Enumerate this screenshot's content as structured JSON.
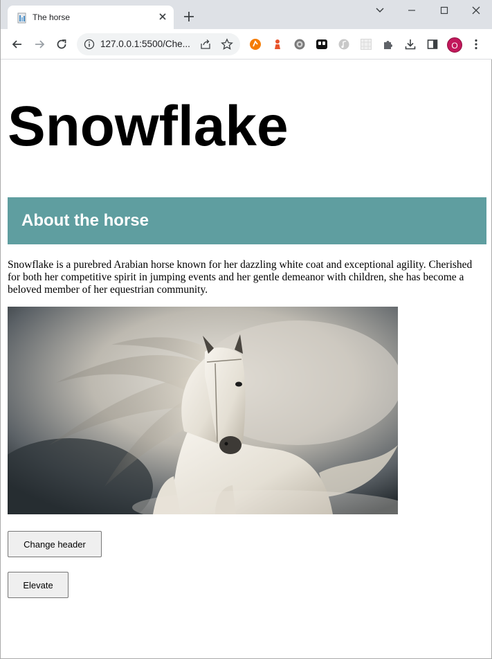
{
  "browser": {
    "tab_title": "The horse",
    "url": "127.0.0.1:5500/Che...",
    "profile_initial": "O"
  },
  "page": {
    "title": "Snowflake",
    "section_heading": "About the horse",
    "section_color": "#5f9ea0",
    "description": "Snowflake is a purebred Arabian horse known for her dazzling white coat and exceptional agility. Cherished for both her competitive spirit in jumping events and her gentle demeanor with children, she has become a beloved member of her equestrian community.",
    "buttons": {
      "change_header": "Change header",
      "elevate": "Elevate"
    }
  },
  "icons": [
    "tab-favicon",
    "close-icon",
    "plus-icon",
    "chevron-down-icon",
    "minimize-icon",
    "maximize-icon",
    "close-window-icon",
    "back-arrow-icon",
    "forward-arrow-icon",
    "reload-icon",
    "info-icon",
    "share-icon",
    "star-icon",
    "extension-icons",
    "puzzle-icon",
    "download-icon",
    "side-panel-icon",
    "kebab-menu-icon"
  ]
}
